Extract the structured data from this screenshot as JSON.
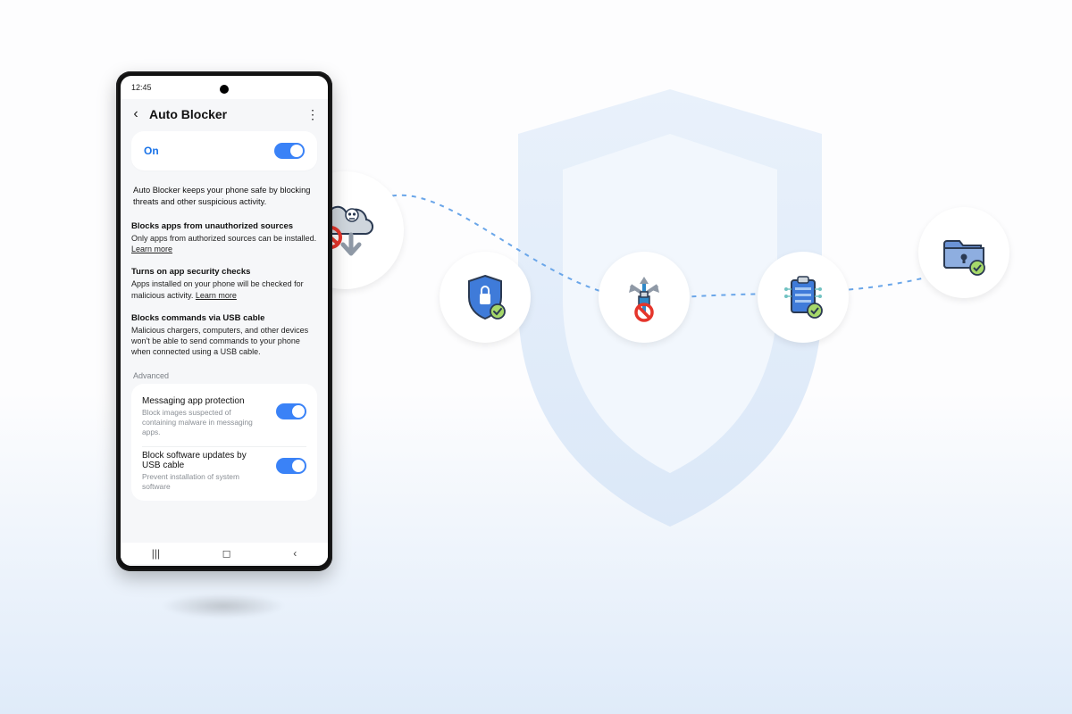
{
  "phone": {
    "status_time": "12:45",
    "header_title": "Auto Blocker",
    "on_label": "On",
    "intro": "Auto Blocker keeps your phone safe by blocking threats and other suspicious activity.",
    "sections": [
      {
        "title": "Blocks apps from unauthorized sources",
        "body": "Only apps from authorized sources can be installed.",
        "learn": "Learn more"
      },
      {
        "title": "Turns on app security checks",
        "body": "Apps installed on your phone will be checked for malicious activity.",
        "learn": "Learn more"
      },
      {
        "title": "Blocks commands via USB cable",
        "body": "Malicious chargers, computers, and other devices won't be able to send commands to your phone when connected using a USB cable.",
        "learn": ""
      }
    ],
    "advanced_label": "Advanced",
    "advanced": [
      {
        "title": "Messaging app protection",
        "sub": "Block images suspected of containing malware in messaging apps."
      },
      {
        "title": "Block software updates by USB cable",
        "sub": "Prevent installation of system software"
      }
    ]
  },
  "features": [
    {
      "name": "block-unauthorized-apps-icon"
    },
    {
      "name": "shield-lock-check-icon"
    },
    {
      "name": "usb-block-icon"
    },
    {
      "name": "clipboard-check-icon"
    },
    {
      "name": "secure-folder-icon"
    }
  ]
}
